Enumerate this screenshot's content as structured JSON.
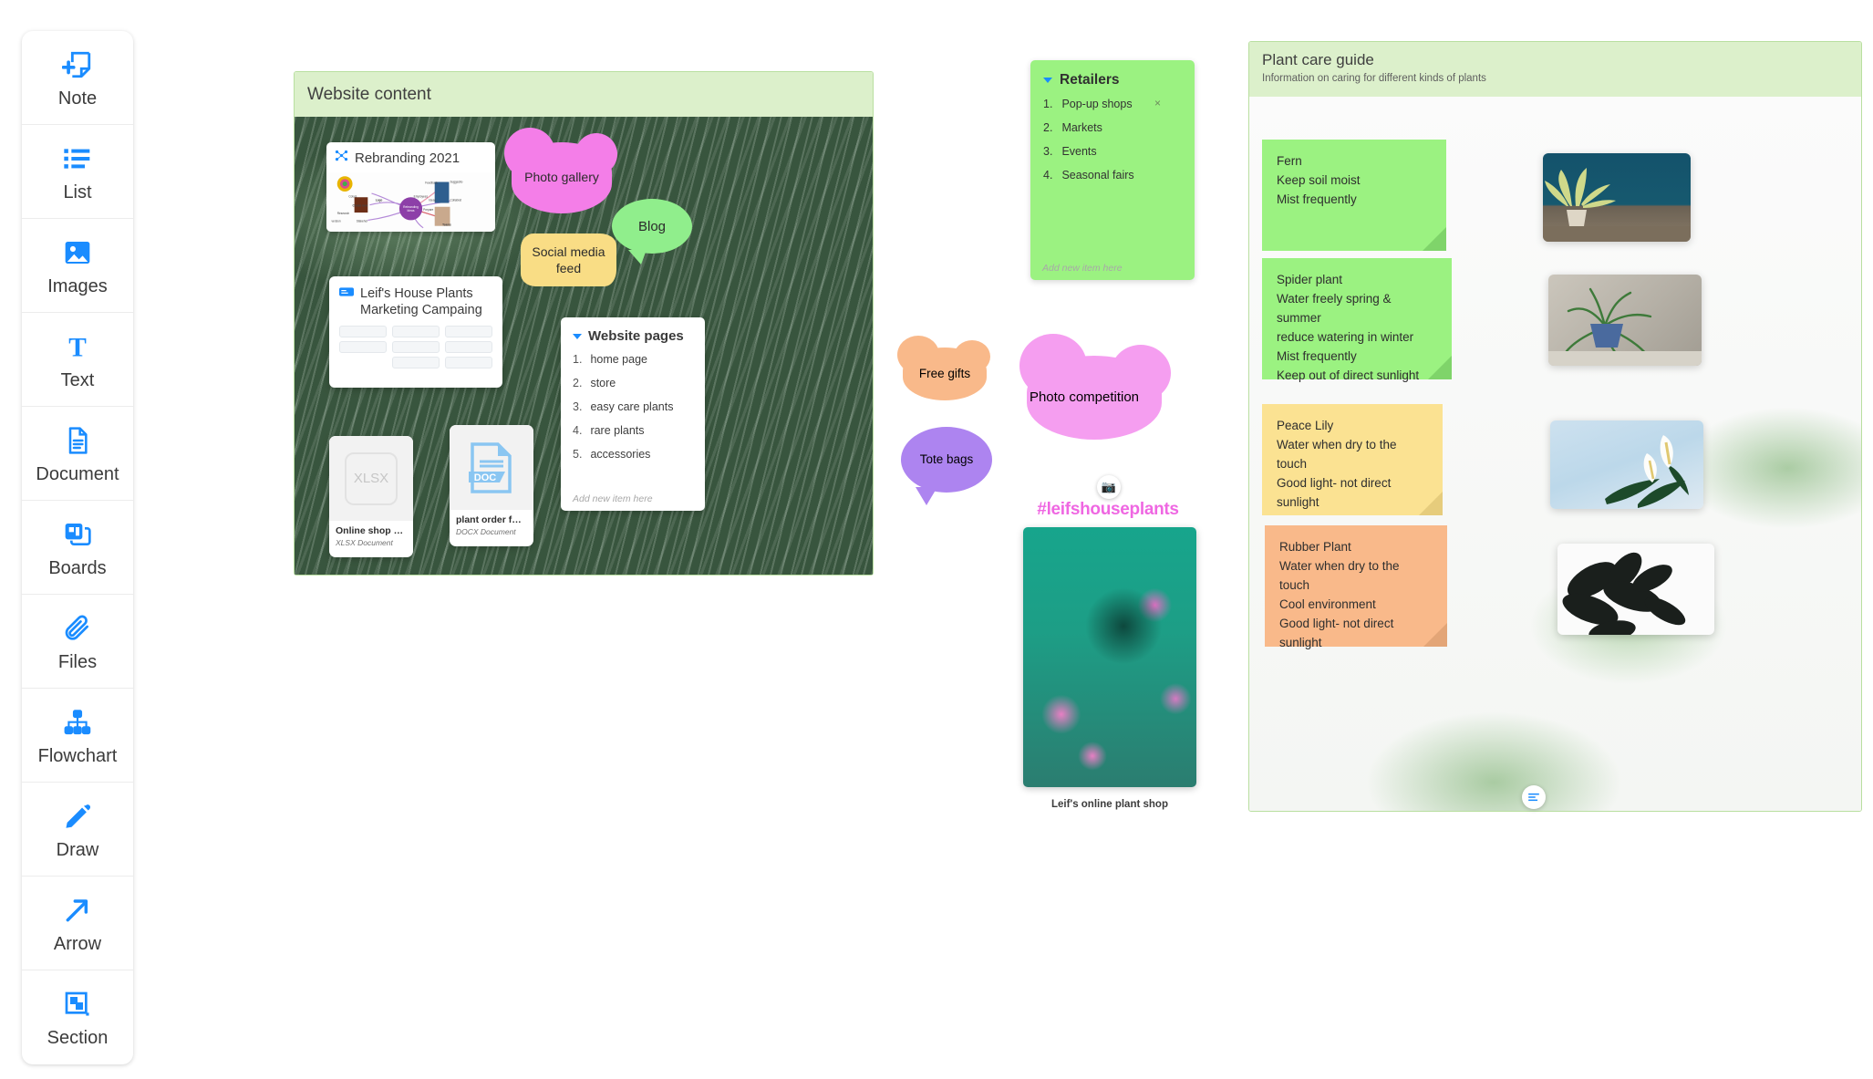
{
  "toolbar": {
    "items": [
      {
        "label": "Note",
        "icon": "add-note-icon"
      },
      {
        "label": "List",
        "icon": "list-icon"
      },
      {
        "label": "Images",
        "icon": "image-icon"
      },
      {
        "label": "Text",
        "icon": "text-icon"
      },
      {
        "label": "Document",
        "icon": "document-icon"
      },
      {
        "label": "Boards",
        "icon": "boards-icon"
      },
      {
        "label": "Files",
        "icon": "paperclip-icon"
      },
      {
        "label": "Flowchart",
        "icon": "flowchart-icon"
      },
      {
        "label": "Draw",
        "icon": "pencil-icon"
      },
      {
        "label": "Arrow",
        "icon": "arrow-icon"
      },
      {
        "label": "Section",
        "icon": "section-icon"
      }
    ]
  },
  "website_section": {
    "title": "Website content",
    "rebranding_card": {
      "title": "Rebranding 2021",
      "icon": "mindmap-icon"
    },
    "kanban_card": {
      "title": "Leif's House Plants Marketing Campaing",
      "icon": "board-icon"
    },
    "pages_list": {
      "title": "Website pages",
      "items": [
        "home page",
        "store",
        "easy care plants",
        "rare plants",
        "accessories"
      ],
      "add_placeholder": "Add new item here"
    },
    "files": [
      {
        "name": "Online shop sal…",
        "type": "XLSX Document",
        "badge": "XLSX"
      },
      {
        "name": "plant order for…",
        "type": "DOCX Document",
        "badge": "DOC"
      }
    ],
    "bubbles": [
      {
        "label": "Photo gallery",
        "color": "#f47ee8"
      },
      {
        "label": "Blog",
        "color": "#90ee8c"
      },
      {
        "label": "Social media feed",
        "color": "#f9dd85"
      }
    ]
  },
  "retailers": {
    "title": "Retailers",
    "items": [
      "Pop-up shops",
      "Markets",
      "Events",
      "Seasonal fairs"
    ],
    "remove_symbol": "×",
    "add_placeholder": "Add new item here"
  },
  "campaign": {
    "bubbles": [
      {
        "label": "Free gifts",
        "color": "#f9b98a"
      },
      {
        "label": "Tote bags",
        "color": "#ad84f0"
      },
      {
        "label": "Photo competition",
        "color": "#f59ef0"
      }
    ],
    "camera_icon": "camera-icon",
    "hashtag": "#leifshouseplants",
    "photo_caption": "Leif's online plant shop"
  },
  "plant_care": {
    "title": "Plant care guide",
    "subtitle": "Information on caring for different kinds of plants",
    "notes": [
      {
        "title": "Fern",
        "lines": [
          "Keep soil moist",
          "Mist frequently"
        ],
        "color": "#9bf281"
      },
      {
        "title": "Spider plant",
        "lines": [
          "Water freely spring & summer",
          "reduce watering in winter",
          "Mist frequently",
          "Keep out of direct sunlight"
        ],
        "color": "#9bf281"
      },
      {
        "title": "Peace Lily",
        "lines": [
          "Water when dry to the touch",
          "Good light- not direct sunlight"
        ],
        "color": "#fbe292"
      },
      {
        "title": "Rubber Plant",
        "lines": [
          "Water when dry to the touch",
          "Cool environment",
          "Good light- not direct sunlight"
        ],
        "color": "#f9b98a"
      }
    ],
    "photos": [
      "fern-photo",
      "spider-plant-photo",
      "peace-lily-photo",
      "rubber-plant-photo"
    ],
    "footer_icon": "text-align-icon"
  },
  "colors": {
    "accent_blue": "#1a8cff",
    "section_header_green": "#dcf0cb",
    "sticky_green": "#9bf281",
    "sticky_yellow": "#fbe292",
    "sticky_orange": "#f9b98a",
    "hashtag_pink": "#ef67e2"
  }
}
